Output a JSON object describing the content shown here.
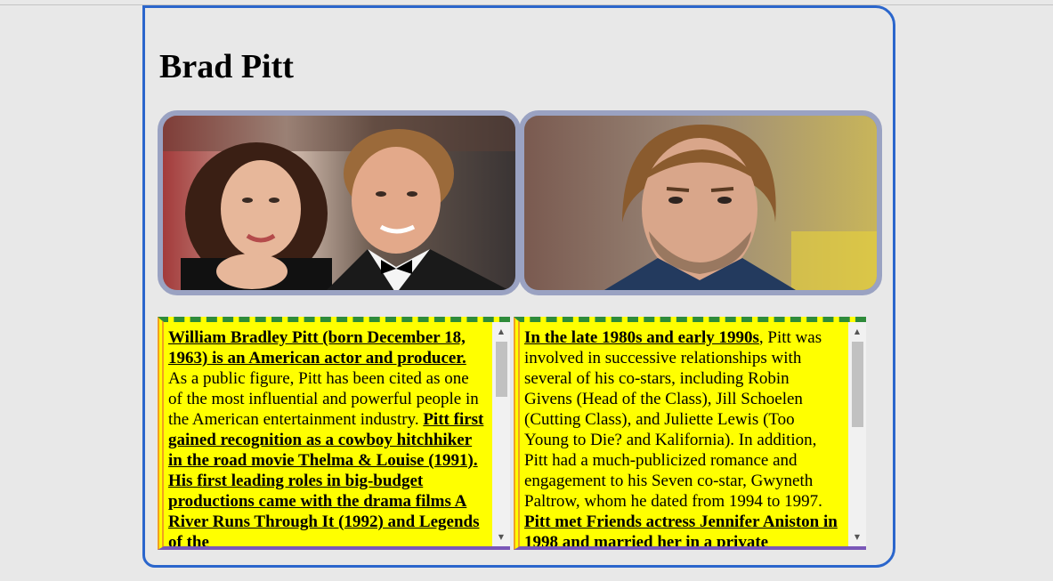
{
  "page": {
    "title": "Brad Pitt"
  },
  "photos": [
    {
      "alt": "Brad Pitt and Angelina Jolie at an event"
    },
    {
      "alt": "Brad Pitt portrait"
    }
  ],
  "articles": [
    {
      "bold_intro": "William Bradley Pitt (born December 18, 1963) is an American actor and producer.",
      "plain": " As a public figure, Pitt has been cited as one of the most influential and powerful people in the American entertainment industry. ",
      "bold_outro": "Pitt first gained recognition as a cowboy hitchhiker in the road movie Thelma & Louise (1991). His first leading roles in big-budget productions came with the drama films A River Runs Through It (1992) and Legends of the"
    },
    {
      "bold_intro": "In the late 1980s and early 1990s",
      "plain": ", Pitt was involved in successive relationships with several of his co-stars, including Robin Givens (Head of the Class), Jill Schoelen (Cutting Class), and Juliette Lewis (Too Young to Die? and Kalifornia). In addition, Pitt had a much-publicized romance and engagement to his Seven co-star, Gwyneth Paltrow, whom he dated from 1994 to 1997. ",
      "bold_outro": "Pitt met Friends actress Jennifer Aniston in 1998 and married her in a private"
    }
  ],
  "scrollbars": {
    "up_arrow": "▲",
    "down_arrow": "▼"
  }
}
